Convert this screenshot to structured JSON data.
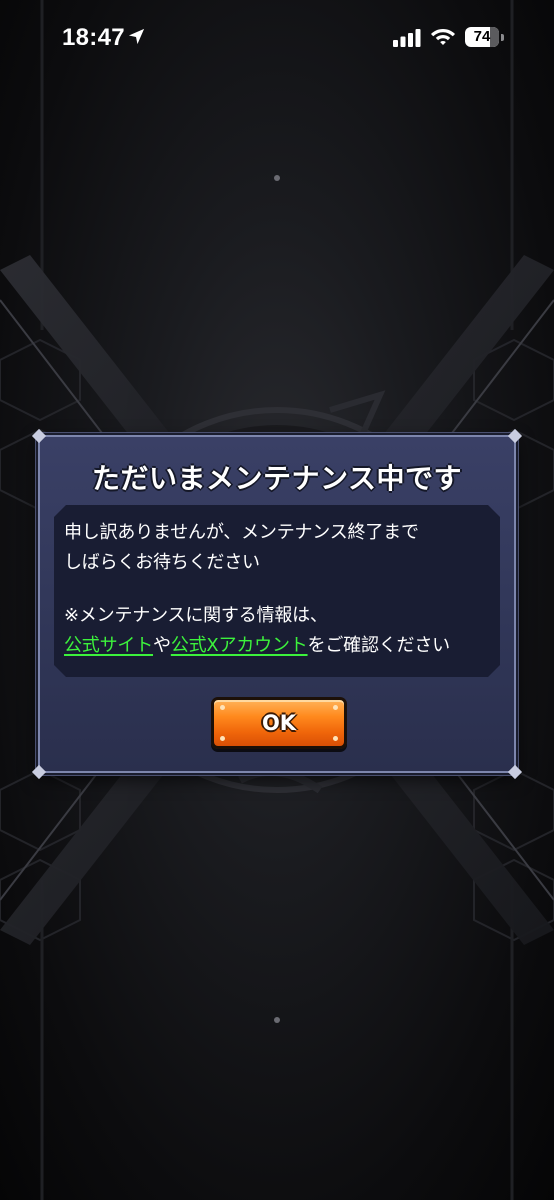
{
  "status_bar": {
    "time": "18:47",
    "battery_level": "74",
    "battery_fraction": 0.74,
    "icons": [
      "location-arrow-icon",
      "cellular-signal-icon",
      "wifi-icon",
      "battery-icon"
    ]
  },
  "dialog": {
    "title": "ただいまメンテナンス中です",
    "message_line1": "申し訳ありませんが、メンテナンス終了まで",
    "message_line2": "しばらくお待ちください",
    "message_line3": "※メンテナンスに関する情報は、",
    "link_official_site": "公式サイト",
    "connector_ya": "や",
    "link_official_x": "公式Xアカウント",
    "message_suffix": "をご確認ください",
    "ok_label": "OK"
  },
  "colors": {
    "dialog_bg": "#343a5e",
    "message_bg": "#191d33",
    "link": "#3cf23c",
    "button": "#f07a12"
  }
}
